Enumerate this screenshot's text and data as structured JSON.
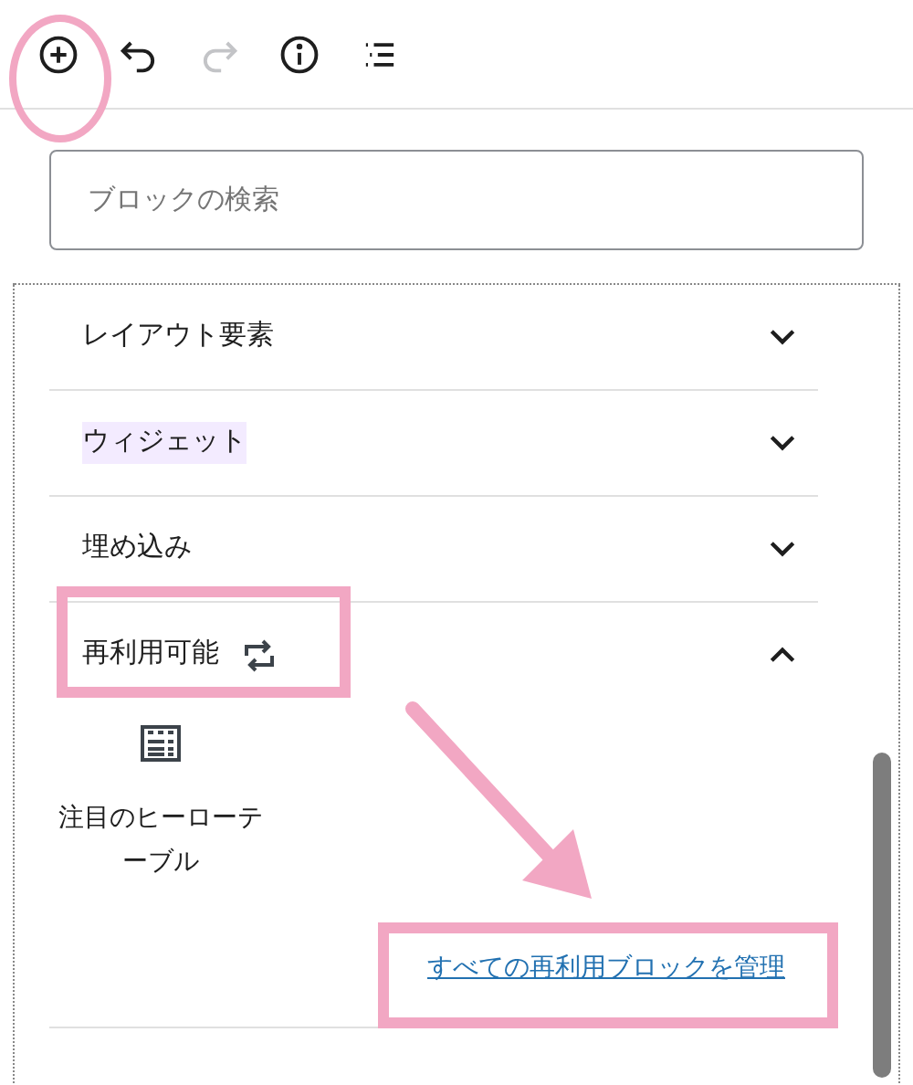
{
  "search": {
    "placeholder": "ブロックの検索"
  },
  "toolbar": [
    {
      "kind": "add",
      "disabled": false
    },
    {
      "kind": "undo",
      "disabled": false
    },
    {
      "kind": "redo",
      "disabled": true
    },
    {
      "kind": "info",
      "disabled": false
    },
    {
      "kind": "list",
      "disabled": false
    }
  ],
  "categories": [
    {
      "label": "レイアウト要素",
      "expanded": false,
      "highlighted": false
    },
    {
      "label": "ウィジェット",
      "expanded": false,
      "highlighted": true
    },
    {
      "label": "埋め込み",
      "expanded": false,
      "highlighted": false
    },
    {
      "label": "再利用可能",
      "expanded": true,
      "highlighted": false,
      "kind": "reusable",
      "blocks": [
        {
          "label": "注目のヒーローテーブル"
        }
      ],
      "link": "すべての再利用ブロックを管理"
    }
  ]
}
